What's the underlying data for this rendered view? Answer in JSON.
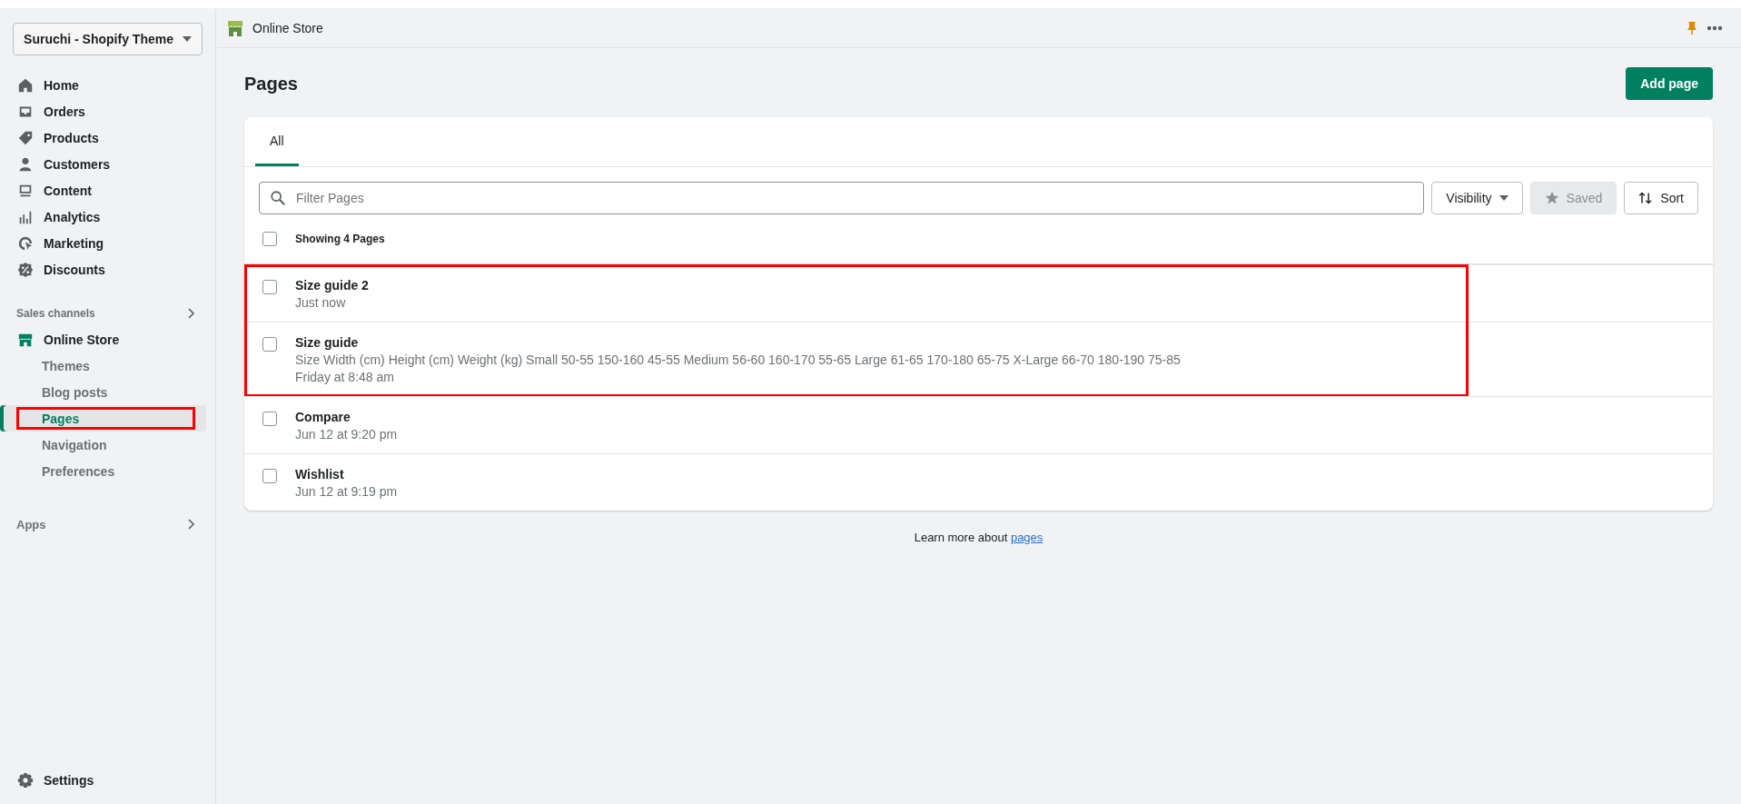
{
  "store_selector": {
    "label": "Suruchi - Shopify Theme"
  },
  "nav": [
    {
      "label": "Home",
      "selected": false
    },
    {
      "label": "Orders",
      "selected": false
    },
    {
      "label": "Products",
      "selected": false
    },
    {
      "label": "Customers",
      "selected": false
    },
    {
      "label": "Content",
      "selected": false
    },
    {
      "label": "Analytics",
      "selected": false
    },
    {
      "label": "Marketing",
      "selected": false
    },
    {
      "label": "Discounts",
      "selected": false
    }
  ],
  "sales_channels": {
    "label": "Sales channels",
    "channel": "Online Store",
    "subitems": [
      {
        "label": "Themes",
        "selected": false,
        "highlighted": false
      },
      {
        "label": "Blog posts",
        "selected": false,
        "highlighted": false
      },
      {
        "label": "Pages",
        "selected": true,
        "highlighted": true
      },
      {
        "label": "Navigation",
        "selected": false,
        "highlighted": false
      },
      {
        "label": "Preferences",
        "selected": false,
        "highlighted": false
      }
    ]
  },
  "apps": {
    "label": "Apps"
  },
  "settings": {
    "label": "Settings"
  },
  "top_bar": {
    "title": "Online Store"
  },
  "page": {
    "title": "Pages",
    "add_button": "Add page",
    "tabs": [
      {
        "label": "All",
        "selected": true
      }
    ],
    "filter": {
      "placeholder": "Filter Pages"
    },
    "visibility_button": "Visibility",
    "saved_button": {
      "label": "Saved",
      "disabled": true
    },
    "sort_button": "Sort",
    "count_label": "Showing 4 Pages",
    "select_all_checked": false,
    "rows": [
      {
        "title": "Size guide 2",
        "lines": [
          "Just now"
        ],
        "checked": false,
        "highlighted": true
      },
      {
        "title": "Size guide",
        "lines": [
          "Size Width (cm) Height (cm) Weight (kg) Small 50-55 150-160 45-55 Medium 56-60 160-170 55-65 Large 61-65 170-180 65-75 X-Large 66-70 180-190 75-85",
          "Friday at 8:48 am"
        ],
        "checked": false,
        "highlighted": true
      },
      {
        "title": "Compare",
        "lines": [
          "Jun 12 at 9:20 pm"
        ],
        "checked": false,
        "highlighted": false
      },
      {
        "title": "Wishlist",
        "lines": [
          "Jun 12 at 9:19 pm"
        ],
        "checked": false,
        "highlighted": false
      }
    ]
  },
  "footer": {
    "text": "Learn more about",
    "link": "pages"
  }
}
